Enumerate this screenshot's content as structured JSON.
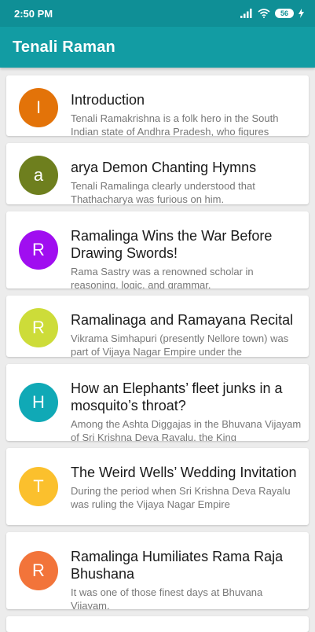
{
  "status_bar": {
    "time": "2:50 PM",
    "battery": "56",
    "icons": [
      "signal-icon",
      "wifi-icon",
      "battery-icon",
      "charging-icon"
    ]
  },
  "app_bar": {
    "title": "Tenali Raman"
  },
  "stories": [
    {
      "letter": "I",
      "color": "#e37309",
      "title": "Introduction",
      "desc": "Tenali Ramakrishna is a folk hero in the South Indian state of Andhra Pradesh, who figures"
    },
    {
      "letter": "a",
      "color": "#6e7f1e",
      "title": "arya Demon Chanting Hymns",
      "desc": "Tenali Ramalinga clearly understood that Thathacharya was furious on him."
    },
    {
      "letter": "R",
      "color": "#a00ef0",
      "title": "Ramalinga Wins the War Before Drawing Swords!",
      "desc": "Rama Sastry was a renowned scholar in reasoning, logic, and grammar."
    },
    {
      "letter": "R",
      "color": "#cddc39",
      "title": "Ramalinaga and Ramayana Recital",
      "desc": "Vikrama Simhapuri (presently Nellore town) was part of Vijaya Nagar Empire under the"
    },
    {
      "letter": "H",
      "color": "#10a9b6",
      "title": "How an Elephants’ fleet junks in a mosquito’s throat?",
      "desc": "Among the Ashta Diggajas in the Bhuvana Vijayam of Sri Krishna Deva Rayalu, the King"
    },
    {
      "letter": "T",
      "color": "#fbc02d",
      "title": "The Weird Wells’ Wedding Invitation",
      "desc": "During the period when Sri Krishna Deva Rayalu was ruling the Vijaya Nagar Empire"
    },
    {
      "letter": "R",
      "color": "#f2743a",
      "title": "Ramalinga Humiliates Rama Raja Bhushana",
      "desc": "It was one of those finest days at Bhuvana Vijayam."
    }
  ]
}
